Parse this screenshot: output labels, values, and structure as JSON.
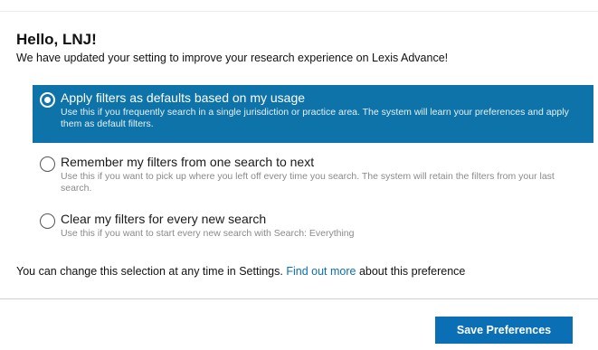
{
  "header": {
    "greeting": "Hello, LNJ!",
    "intro": "We have updated your setting to improve your research experience on Lexis Advance!"
  },
  "options": [
    {
      "title": "Apply filters as defaults based on my usage",
      "description": "Use this if you frequently search in a single jurisdiction or practice area. The system will learn your preferences and apply them as default filters.",
      "selected": true
    },
    {
      "title": "Remember my filters from one search to next",
      "description": "Use this if you want to pick up where you left off every time you search. The system will retain the filters from your last search.",
      "selected": false
    },
    {
      "title": "Clear my filters for every new search",
      "description": "Use this if you want to start every new search with Search: Everything",
      "selected": false
    }
  ],
  "footer": {
    "note_before": "You can change this selection at any time in Settings. ",
    "link_text": "Find out more",
    "note_after": " about this preference"
  },
  "actions": {
    "save_label": "Save Preferences"
  },
  "colors": {
    "selected_background": "#0e73a8",
    "primary_button": "#0a6fb5",
    "link": "#0a6fb5"
  }
}
